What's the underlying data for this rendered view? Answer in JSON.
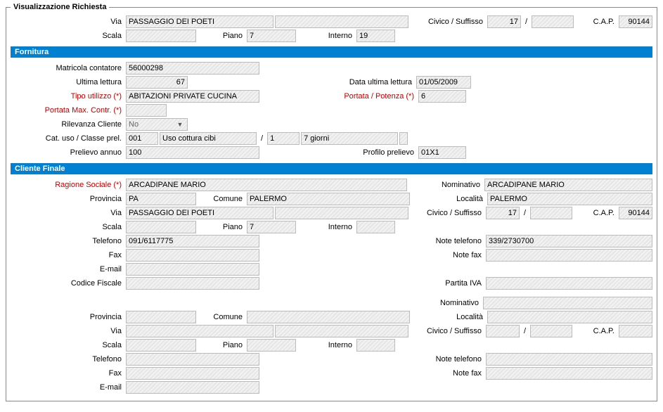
{
  "legend": "Visualizzazione Richiesta",
  "addr1": {
    "via_label": "Via",
    "via": "PASSAGGIO DEI POETI",
    "civico_label": "Civico / Suffisso",
    "civico": "17",
    "suffisso": "",
    "cap_label": "C.A.P.",
    "cap": "90144",
    "scala_label": "Scala",
    "scala": "",
    "piano_label": "Piano",
    "piano": "7",
    "interno_label": "Interno",
    "interno": "19"
  },
  "section_fornitura": "Fornitura",
  "forn": {
    "matricola_label": "Matricola contatore",
    "matricola": "56000298",
    "ultima_lettura_label": "Ultima lettura",
    "ultima_lettura": "67",
    "data_ultima_lettura_label": "Data ultima lettura",
    "data_ultima_lettura": "01/05/2009",
    "tipo_utilizzo_label": "Tipo utilizzo (*)",
    "tipo_utilizzo": "ABITAZIONI PRIVATE CUCINA",
    "portata_label": "Portata / Potenza (*)",
    "portata": "6",
    "portata_max_label": "Portata Max. Contr. (*)",
    "portata_max": "",
    "rilevanza_label": "Rilevanza Cliente",
    "rilevanza": "No",
    "catuso_label": "Cat. uso / Classe prel.",
    "catuso_code": "001",
    "catuso_desc": "Uso cottura cibi",
    "classe_code": "1",
    "classe_desc": "7 giorni",
    "classe_extra": "",
    "prelievo_annuo_label": "Prelievo annuo",
    "prelievo_annuo": "100",
    "profilo_label": "Profilo prelievo",
    "profilo": "01X1"
  },
  "section_cliente": "Cliente Finale",
  "cli": {
    "ragione_label": "Ragione Sociale (*)",
    "ragione": "ARCADIPANE MARIO",
    "nominativo_label": "Nominativo",
    "nominativo1": "ARCADIPANE MARIO",
    "provincia_label": "Provincia",
    "provincia": "PA",
    "comune_label": "Comune",
    "comune": "PALERMO",
    "localita_label": "Località",
    "localita": "PALERMO",
    "via_label": "Via",
    "via": "PASSAGGIO DEI POETI",
    "civico_label": "Civico / Suffisso",
    "civico": "17",
    "suffisso": "",
    "cap_label": "C.A.P.",
    "cap": "90144",
    "scala_label": "Scala",
    "scala": "",
    "piano_label": "Piano",
    "piano": "7",
    "interno_label": "Interno",
    "interno": "",
    "telefono_label": "Telefono",
    "telefono": "091/6117775",
    "note_tel_label": "Note telefono",
    "note_tel": "339/2730700",
    "fax_label": "Fax",
    "fax": "",
    "note_fax_label": "Note fax",
    "note_fax": "",
    "email_label": "E-mail",
    "email": "",
    "cf_label": "Codice Fiscale",
    "cf": "",
    "piva_label": "Partita IVA",
    "piva": "",
    "nominativo2": "",
    "localita2": "",
    "provincia2": "",
    "comune2": "",
    "via2": "",
    "civico2": "",
    "suffisso2": "",
    "cap2": "",
    "scala2": "",
    "piano2": "",
    "interno2": "",
    "telefono2": "",
    "note_tel2": "",
    "fax2": "",
    "note_fax2": "",
    "email2": ""
  }
}
